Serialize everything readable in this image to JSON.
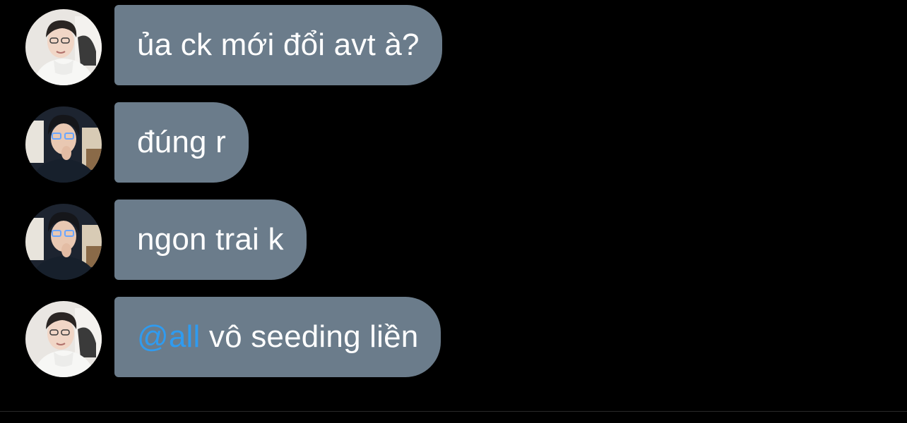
{
  "colors": {
    "background": "#000000",
    "bubble": "#6b7c8b",
    "bubble_text": "#ffffff",
    "mention": "#2f9bf0"
  },
  "messages": [
    {
      "avatar": "user-a-avatar",
      "text": "ủa ck mới đổi avt à?"
    },
    {
      "avatar": "user-b-avatar",
      "text": "đúng r"
    },
    {
      "avatar": "user-b-avatar",
      "text": "ngon trai k"
    },
    {
      "avatar": "user-a-avatar",
      "mention": "@all",
      "text": " vô seeding liền"
    }
  ]
}
